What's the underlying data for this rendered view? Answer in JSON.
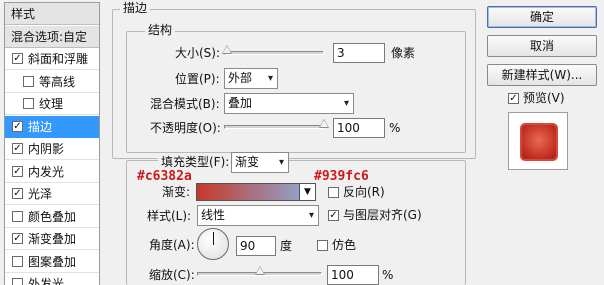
{
  "left_panel": {
    "items": [
      {
        "label": "样式",
        "header": true
      },
      {
        "label": "混合选项:自定",
        "header": true
      },
      {
        "label": "斜面和浮雕",
        "checked": true
      },
      {
        "label": "等高线",
        "checked": false,
        "indent": true
      },
      {
        "label": "纹理",
        "checked": false,
        "indent": true
      },
      {
        "label": "描边",
        "checked": true,
        "selected": true
      },
      {
        "label": "内阴影",
        "checked": true
      },
      {
        "label": "内发光",
        "checked": true
      },
      {
        "label": "光泽",
        "checked": true
      },
      {
        "label": "颜色叠加",
        "checked": false
      },
      {
        "label": "渐变叠加",
        "checked": true
      },
      {
        "label": "图案叠加",
        "checked": false
      },
      {
        "label": "外发光",
        "checked": false
      }
    ]
  },
  "stroke": {
    "section_title": "描边",
    "structure_title": "结构",
    "size_label": "大小(S):",
    "size_value": "3",
    "size_unit": "像素",
    "size_slider": 0.03,
    "position_label": "位置(P):",
    "position_value": "外部",
    "blend_label": "混合模式(B):",
    "blend_value": "叠加",
    "opacity_label": "不透明度(O):",
    "opacity_value": "100",
    "opacity_unit": "%",
    "opacity_slider": 1.0
  },
  "fill": {
    "fill_type_label": "填充类型(F):",
    "fill_type_value": "渐变",
    "gradient_label": "渐变:",
    "gradient_start_color": "#c6382a",
    "gradient_end_color": "#939fc6",
    "annotation_left": "#c6382a",
    "annotation_right": "#939fc6",
    "reverse_label": "反向(R)",
    "reverse_checked": false,
    "style_label": "样式(L):",
    "style_value": "线性",
    "align_label": "与图层对齐(G)",
    "align_checked": true,
    "angle_label": "角度(A):",
    "angle_value": "90",
    "angle_unit": "度",
    "dither_label": "仿色",
    "dither_checked": false,
    "scale_label": "缩放(C):",
    "scale_value": "100",
    "scale_unit": "%",
    "scale_slider": 0.5
  },
  "buttons": {
    "ok": "确定",
    "cancel": "取消",
    "new_style": "新建样式(W)..."
  },
  "preview": {
    "label": "预览(V)",
    "checked": true
  }
}
